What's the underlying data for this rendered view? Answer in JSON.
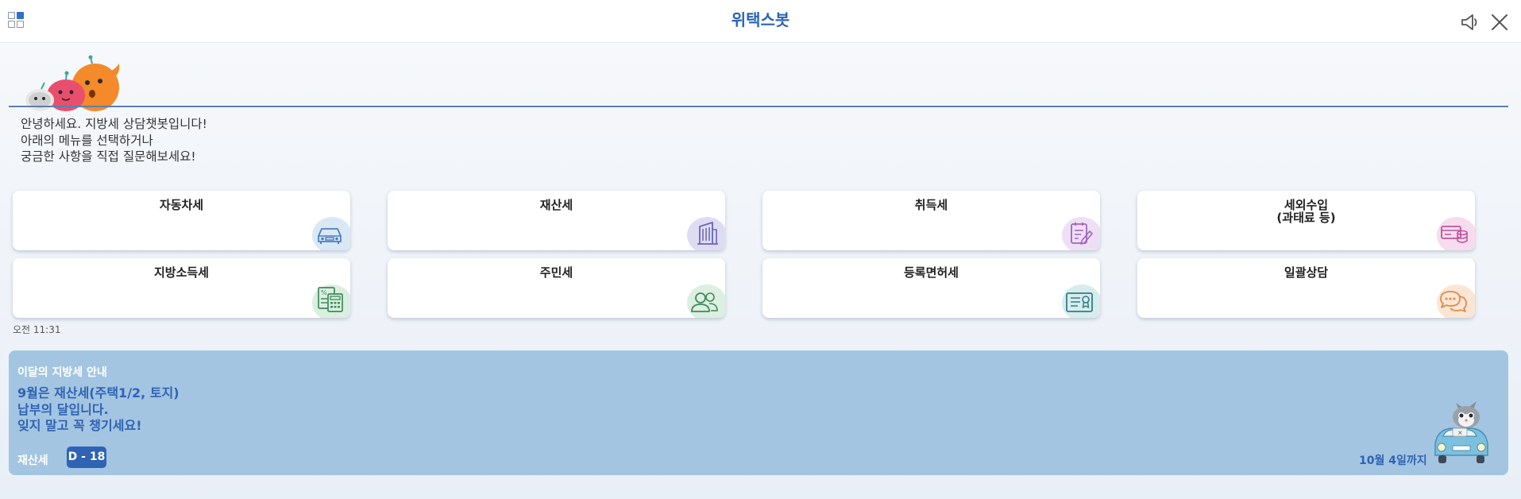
{
  "header": {
    "title": "위택스봇",
    "icons": {
      "menu": "grid-menu-icon",
      "speaker": "speaker-icon",
      "close": "close-icon"
    }
  },
  "greeting": {
    "lines": [
      "안녕하세요. 지방세 상담챗봇입니다!",
      "아래의 메뉴를 선택하거나",
      "궁금한 사항을 직접 질문해보세요!"
    ]
  },
  "menu_tiles": [
    {
      "label": "자동차세",
      "icon": "car-icon",
      "icon_bg": "#dae8f5",
      "icon_color": "#4a7fc0"
    },
    {
      "label": "재산세",
      "icon": "building-icon",
      "icon_bg": "#dedcf3",
      "icon_color": "#6a64b8"
    },
    {
      "label": "취득세",
      "icon": "document-pen-icon",
      "icon_bg": "#eee0f4",
      "icon_color": "#a264c0"
    },
    {
      "label": "세외수입\n(과태료 등)",
      "icon": "money-stack-icon",
      "icon_bg": "#f6dcee",
      "icon_color": "#c0559c"
    },
    {
      "label": "지방소득세",
      "icon": "calculator-icon",
      "icon_bg": "#dbefe0",
      "icon_color": "#3f8a5c"
    },
    {
      "label": "주민세",
      "icon": "people-icon",
      "icon_bg": "#dcefe1",
      "icon_color": "#3f8a5c"
    },
    {
      "label": "등록면허세",
      "icon": "license-icon",
      "icon_bg": "#d8ecee",
      "icon_color": "#2f7f86"
    },
    {
      "label": "일괄상담",
      "icon": "chat-bubbles-icon",
      "icon_bg": "#fbe6d6",
      "icon_color": "#e08a45"
    }
  ],
  "timestamp": "오전 11:31",
  "notice": {
    "heading": "이달의 지방세 안내",
    "body_lines": [
      "9월은 재산세(주택1/2, 토지)",
      "납부의 달입니다.",
      "잊지 말고 꼭 챙기세요!"
    ],
    "tax_name": "재산세",
    "dday": "D - 18",
    "due_date": "10월 4일까지"
  },
  "colors": {
    "brand": "#2a63b5",
    "notice_bg": "#a3c5e1",
    "badge_bg": "#2f63b4"
  }
}
